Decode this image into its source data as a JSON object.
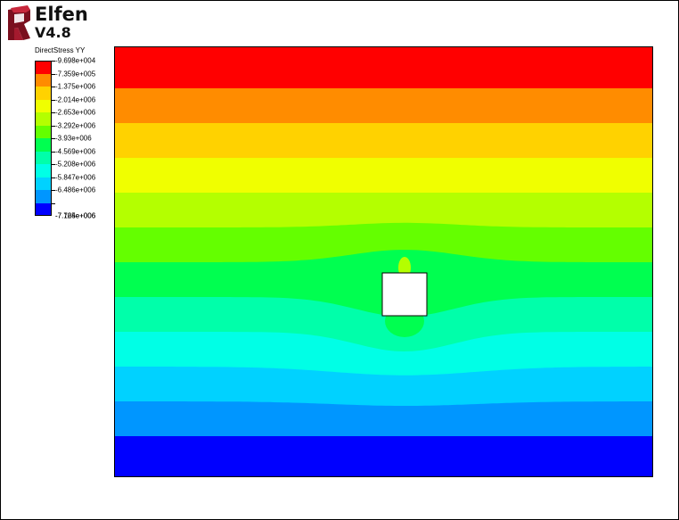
{
  "app": {
    "name": "Elfen",
    "version": "V4.8"
  },
  "legend": {
    "title": "DirectStress YY",
    "labels": [
      "-9.698e+004",
      "-7.359e+005",
      "-1.375e+006",
      "-2.014e+006",
      "-2.653e+006",
      "-3.292e+006",
      "-3.93e+006",
      "-4.569e+006",
      "-5.208e+006",
      "-5.847e+006",
      "-6.486e+006",
      "-7.125e+006",
      "-7.764e+006"
    ],
    "colors": [
      "#ff0000",
      "#ff8c00",
      "#ffd200",
      "#f0ff00",
      "#b4ff00",
      "#64ff00",
      "#00ff50",
      "#00ffaa",
      "#00ffe6",
      "#00d2ff",
      "#0096ff",
      "#0000ff"
    ]
  },
  "plot": {
    "background": "#ffffff",
    "hole_color": "#ffffff",
    "outline_color": "#000000"
  }
}
